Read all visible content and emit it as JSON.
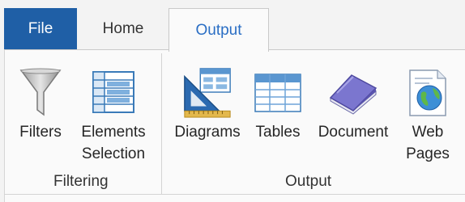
{
  "tabs": {
    "file": "File",
    "home": "Home",
    "output": "Output"
  },
  "groups": {
    "filtering": {
      "label": "Filtering",
      "buttons": {
        "filters": "Filters",
        "elements_selection": "Elements\nSelection"
      }
    },
    "output": {
      "label": "Output",
      "buttons": {
        "diagrams": "Diagrams",
        "tables": "Tables",
        "document": "Document",
        "web_pages": "Web\nPages"
      }
    }
  },
  "colors": {
    "file_tab": "#1f5fa6",
    "active_tab_text": "#2a6ec4"
  }
}
